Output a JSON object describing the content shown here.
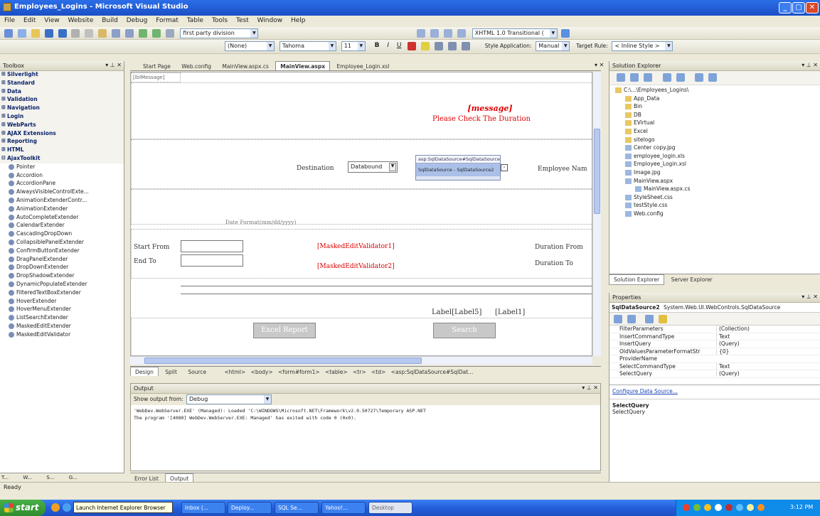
{
  "window": {
    "title": "Employees_Logins - Microsoft Visual Studio"
  },
  "menu": [
    "File",
    "Edit",
    "View",
    "Website",
    "Build",
    "Debug",
    "Format",
    "Table",
    "Tools",
    "Test",
    "Window",
    "Help"
  ],
  "toolbar": {
    "division_combo": "first party division",
    "doctype_combo": "XHTML 1.0 Transitional (",
    "style_combo": "(None)",
    "font_combo": "Tahoma",
    "size_combo": "11",
    "style_application": "Style Application:",
    "manual": "Manual",
    "target_rule": "Target Rule:",
    "inline_style": "< Inline Style >"
  },
  "toolbox": {
    "header": "Toolbox",
    "categories": [
      "Silverlight",
      "Standard",
      "Data",
      "Validation",
      "Navigation",
      "Login",
      "WebParts",
      "AJAX Extensions",
      "Reporting",
      "HTML",
      "AjaxToolkit"
    ],
    "items": [
      "Pointer",
      "Accordion",
      "AccordionPane",
      "AlwaysVisibleControlExte...",
      "AnimationExtenderContr...",
      "AnimationExtender",
      "AutoCompleteExtender",
      "CalendarExtender",
      "CascadingDropDown",
      "CollapsiblePanelExtender",
      "ConfirmButtonExtender",
      "DragPanelExtender",
      "DropDownExtender",
      "DropShadowExtender",
      "DynamicPopulateExtender",
      "FilteredTextBoxExtender",
      "HoverExtender",
      "HoverMenuExtender",
      "ListSearchExtender",
      "MaskedEditExtender",
      "MaskedEditValidator"
    ],
    "bottom_tabs": [
      "T...",
      "W...",
      "S...",
      "G..."
    ]
  },
  "doc_tabs": [
    "Start Page",
    "Web.config",
    "MainView.aspx.cs",
    "MainView.aspx",
    "Employee_Login.xsl"
  ],
  "design": {
    "literal": "[lblMessage]",
    "message_italic": "[message]",
    "message_check": "Please Check The Duration",
    "destination_label": "Destination",
    "destination_value": "Databound",
    "sds_tag": "asp:SqlDataSource#SqlDataSource2",
    "sds_value": "SqlDataSource - SqlDataSource2",
    "employee_name": "Employee Nam",
    "date_format": "Date Format(mm/dd/yyyy)",
    "start_from": "Start From",
    "end_to": "End To",
    "validator1": "[MaskedEditValidator1]",
    "validator2": "[MaskedEditValidator2]",
    "duration_from": "Duration From",
    "duration_to": "Duration To",
    "label5": "Label[Label5]",
    "label1": "[Label1]",
    "excel_button": "Excel Report",
    "search_button": "Search"
  },
  "view_bar": {
    "design": "Design",
    "split": "Split",
    "source": "Source",
    "crumbs": [
      "<html>",
      "<body>",
      "<form#form1>",
      "<table>",
      "<tr>",
      "<td>",
      "<asp:SqlDataSource#SqlDat..."
    ]
  },
  "output": {
    "header": "Output",
    "show_from": "Show output from:",
    "source": "Debug",
    "line1": "'WebDev.WebServer.EXE' (Managed): Loaded 'C:\\WINDOWS\\Microsoft.NET\\Framework\\v2.0.50727\\Temporary ASP.NET",
    "line2": "The program '[4080] WebDev.WebServer.EXE: Managed' has exited with code 0 (0x0).",
    "tabs": [
      "Error List",
      "Output"
    ]
  },
  "solution": {
    "header": "Solution Explorer",
    "items": [
      {
        "name": "C:\\...\\Employees_Logins\\",
        "level": 0
      },
      {
        "name": "App_Data",
        "level": 1
      },
      {
        "name": "Bin",
        "level": 1
      },
      {
        "name": "DB",
        "level": 1
      },
      {
        "name": "EVirtual",
        "level": 1
      },
      {
        "name": "Excel",
        "level": 1
      },
      {
        "name": "sitelogo",
        "level": 1
      },
      {
        "name": "Center copy.jpg",
        "level": 1
      },
      {
        "name": "employee_login.xls",
        "level": 1
      },
      {
        "name": "Employee_Login.xsl",
        "level": 1
      },
      {
        "name": "Image.jpg",
        "level": 1
      },
      {
        "name": "MainView.aspx",
        "level": 1
      },
      {
        "name": "MainView.aspx.cs",
        "level": 2
      },
      {
        "name": "StyleSheet.css",
        "level": 1
      },
      {
        "name": "testStyle.css",
        "level": 1
      },
      {
        "name": "Web.config",
        "level": 1
      }
    ],
    "tabs": [
      "Solution Explorer",
      "Server Explorer"
    ]
  },
  "properties": {
    "header": "Properties",
    "object": "SqlDataSource2",
    "object_type": "System.Web.UI.WebControls.SqlDataSource",
    "rows": [
      {
        "name": "FilterParameters",
        "value": "(Collection)"
      },
      {
        "name": "InsertCommandType",
        "value": "Text"
      },
      {
        "name": "InsertQuery",
        "value": "(Query)"
      },
      {
        "name": "OldValuesParameterFormatStr",
        "value": "{0}"
      },
      {
        "name": "ProviderName",
        "value": ""
      },
      {
        "name": "SelectCommandType",
        "value": "Text"
      },
      {
        "name": "SelectQuery",
        "value": "(Query)"
      }
    ],
    "link": "Configure Data Source...",
    "desc_title": "SelectQuery",
    "desc_text": "SelectQuery"
  },
  "status": "Ready",
  "taskbar": {
    "start": "start",
    "tooltip": "Launch Internet Explorer Browser",
    "tasks": [
      "Inbox (...",
      "Deploy...",
      "SQL Se...",
      "Yahoo!...",
      "Desktop"
    ],
    "clock": "3:12 PM"
  },
  "colors": {
    "accent": "#0a246a",
    "red_text": "#dd0000",
    "taskbar": "#245edb"
  }
}
